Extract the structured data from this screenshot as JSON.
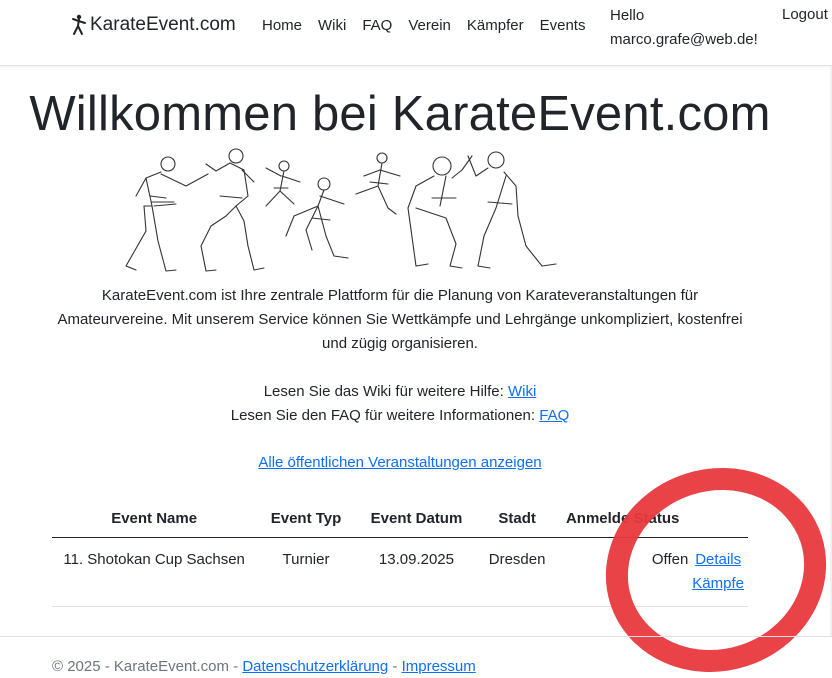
{
  "nav": {
    "brand": "KarateEvent.com",
    "links": [
      "Home",
      "Wiki",
      "FAQ",
      "Verein",
      "Kämpfer",
      "Events"
    ],
    "hello_line1": "Hello",
    "hello_line2": "marco.grafe@web.de!",
    "logout": "Logout"
  },
  "main": {
    "title": "Willkommen bei KarateEvent.com",
    "intro": "KarateEvent.com ist Ihre zentrale Plattform für die Planung von Karateveranstaltungen für Amateurvereine. Mit unserem Service können Sie Wettkämpfe und Lehrgänge unkompliziert, kostenfrei und zügig organisieren.",
    "wiki_text": "Lesen Sie das Wiki für weitere Hilfe: ",
    "wiki_link": "Wiki",
    "faq_text": "Lesen Sie den FAQ für weitere Informationen: ",
    "faq_link": "FAQ",
    "all_events_link": "Alle öffentlichen Veranstaltungen anzeigen"
  },
  "table": {
    "headers": [
      "Event Name",
      "Event Typ",
      "Event Datum",
      "Stadt",
      "Anmelde Status",
      ""
    ],
    "rows": [
      {
        "name": "11. Shotokan Cup Sachsen",
        "typ": "Turnier",
        "datum": "13.09.2025",
        "stadt": "Dresden",
        "status": "Offen",
        "details": "Details",
        "kaempfe": "Kämpfe"
      }
    ]
  },
  "footer": {
    "copyright": "© 2025 - KarateEvent.com - ",
    "privacy": "Datenschutzerklärung",
    "sep": " - ",
    "impressum": "Impressum"
  },
  "colors": {
    "link": "#0d6efd",
    "annotation": "#e8383d"
  }
}
